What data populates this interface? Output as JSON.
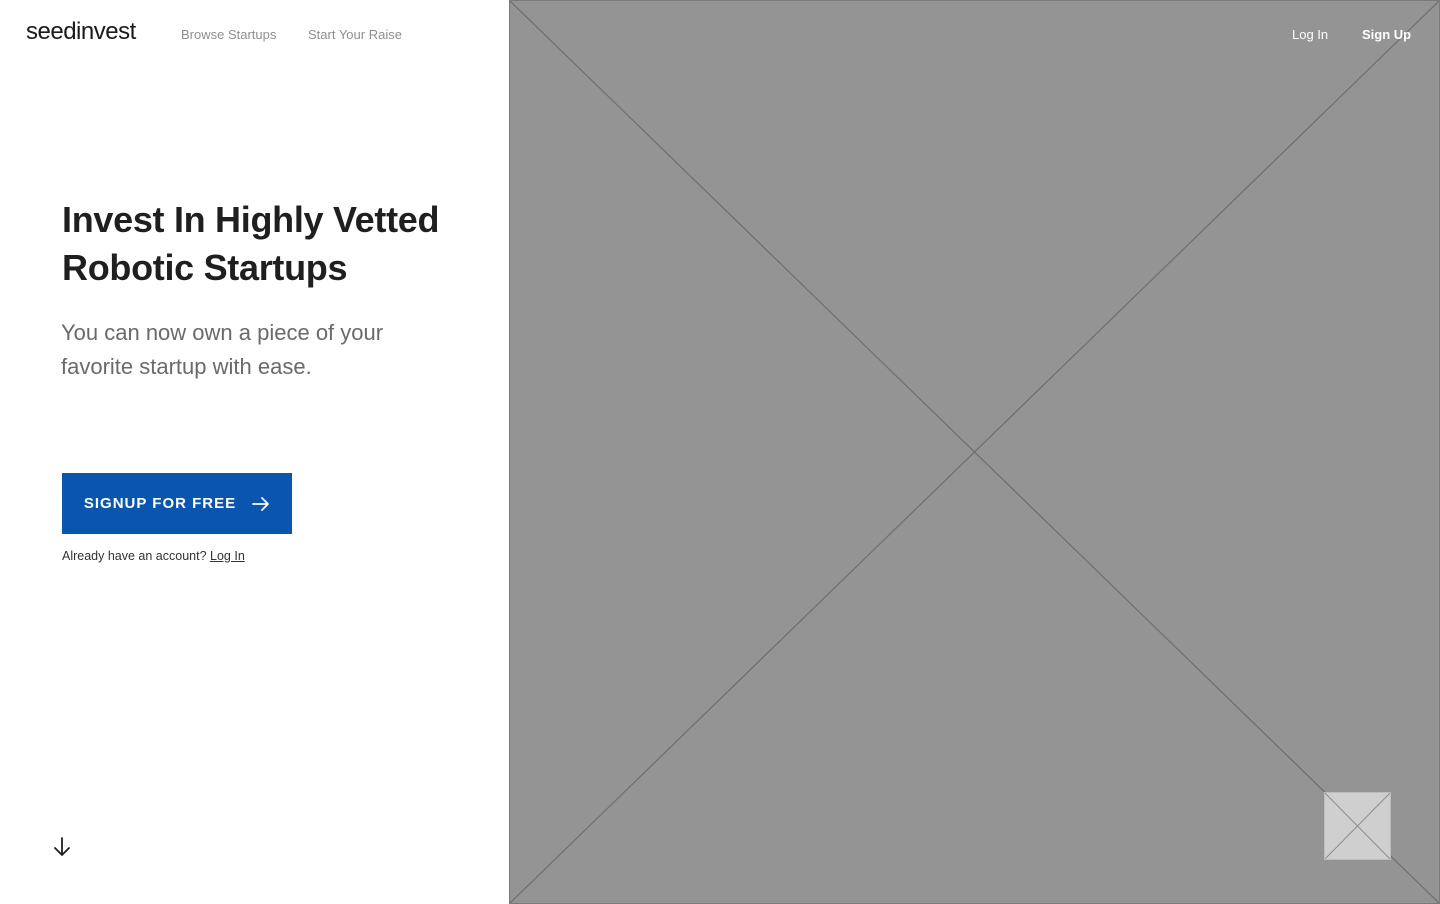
{
  "header": {
    "logo_text": "seedinvest",
    "nav": {
      "browse": "Browse Startups",
      "raise": "Start Your Raise"
    },
    "login": "Log In",
    "signup": "Sign Up"
  },
  "hero": {
    "title": "Invest In Highly Vetted Robotic Startups",
    "subtitle": "You can now own a piece of your favorite startup with ease.",
    "cta_label": "SIGNUP FOR FREE",
    "account_prompt": "Already have an account?",
    "account_login": "Log In"
  },
  "icons": {
    "cta_arrow": "arrow-right-icon",
    "scroll": "arrow-down-icon"
  },
  "colors": {
    "accent": "#0a55ad",
    "placeholder": "#949494",
    "nav_muted": "#8f8f8f"
  }
}
